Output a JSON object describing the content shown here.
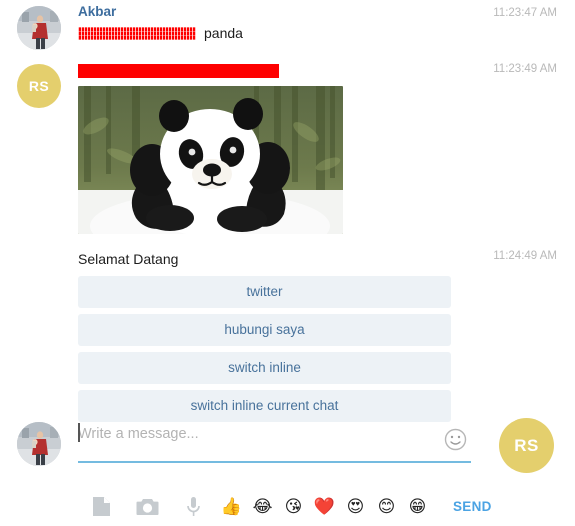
{
  "messages": [
    {
      "sender_name": "Akbar",
      "avatar_type": "photo",
      "avatar_label": "",
      "timestamp": "11:23:47 AM",
      "redacted_bar": "redacted-striped",
      "text": "panda"
    },
    {
      "sender_name": "",
      "avatar_type": "initials",
      "avatar_label": "RS",
      "timestamp": "11:23:49 AM",
      "redacted_bar": "redacted-solid",
      "image_alt": "panda-photo"
    },
    {
      "sender_name": "",
      "avatar_type": "none",
      "avatar_label": "",
      "timestamp": "11:24:49 AM",
      "text": "Selamat Datang",
      "keyboard_buttons": [
        "twitter",
        "hubungi saya",
        "switch inline",
        "switch inline current chat"
      ]
    }
  ],
  "composer": {
    "placeholder": "Write a message...",
    "value": "",
    "avatar_label": "RS",
    "emoji_picker_icon": "smiley-icon"
  },
  "toolbar": {
    "icons": [
      "document-icon",
      "camera-icon",
      "microphone-icon"
    ],
    "emojis": [
      "👍",
      "😂",
      "😘",
      "❤️",
      "😍",
      "😊",
      "😁"
    ],
    "send_label": "SEND"
  },
  "colors": {
    "accent_blue": "#4ba3e3",
    "name_blue": "#3d6d9e",
    "button_bg": "#edf2f6",
    "button_text": "#48729b",
    "avatar_gold": "#e4cf6d",
    "redaction_red": "#fe0000",
    "timestamp_gray": "#b9b9b9",
    "underline_blue": "#74bbe0"
  }
}
